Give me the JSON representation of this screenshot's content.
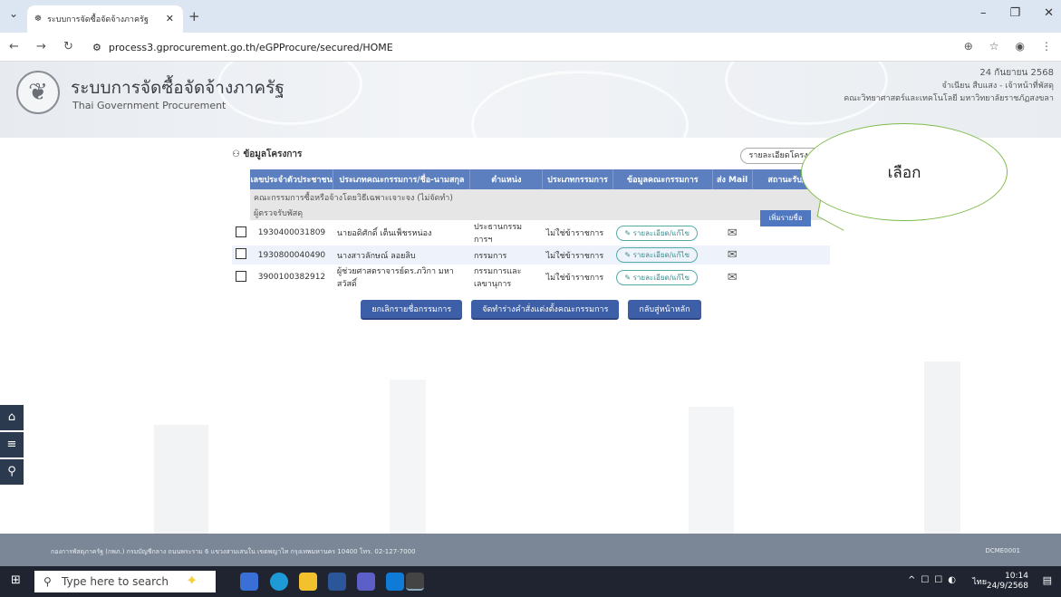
{
  "browser": {
    "tab_title": "ระบบการจัดซื้อจัดจ้างภาครัฐ",
    "url": "process3.gprocurement.go.th/eGPProcure/secured/HOME"
  },
  "header": {
    "title": "ระบบการจัดซื้อจัดจ้างภาครัฐ",
    "subtitle": "Thai Government Procurement",
    "date": "24 กันยายน 2568",
    "user": "จำเนียน สืบแสง - เจ้าหน้าที่พัสดุ",
    "org": "คณะวิทยาศาสตร์และเทคโนโลยี มหาวิทยาลัยราชภัฏสงขลา"
  },
  "panel": {
    "title": "ข้อมูลโครงการ",
    "detail_button": "รายละเอียดโครงการ",
    "columns": [
      "เลขประจำตัวประชาชน",
      "ประเภทคณะกรรมการ/ชื่อ-นามสกุล",
      "ตำแหน่ง",
      "ประเภทกรรมการ",
      "ข้อมูลคณะกรรมการ",
      "ส่ง Mail",
      "สถานะรับ/ส่ง"
    ],
    "section1": "คณะกรรมการซื้อหรือจ้างโดยวิธีเฉพาะเจาะจง (ไม่จัดทำ)",
    "section2": "ผู้ตรวจรับพัสดุ",
    "add_button": "เพิ่มรายชื่อ",
    "edit_label": "รายละเอียด/แก้ไข",
    "rows": [
      {
        "id": "1930400031809",
        "name": "นายอดิศักดิ์ เต็นเพ็ชรหน่อง",
        "position": "ประธานกรรมการฯ",
        "type": "ไม่ใช่ข้าราชการ"
      },
      {
        "id": "1930800040490",
        "name": "นางสาวลักษณ์ ลอยลิบ",
        "position": "กรรมการ",
        "type": "ไม่ใช่ข้าราชการ"
      },
      {
        "id": "3900100382912",
        "name": "ผู้ช่วยศาสตราจารย์ดร.ภวิกา มหาสวัสดิ์",
        "position": "กรรมการและ เลขานุการ",
        "type": "ไม่ใช่ข้าราชการ"
      }
    ],
    "actions": [
      "ยกเลิกรายชื่อกรรมการ",
      "จัดทำร่างคำสั่งแต่งตั้งคณะกรรมการ",
      "กลับสู่หน้าหลัก"
    ]
  },
  "callout": "เลือก",
  "footer": {
    "address": "กองการพัสดุภาครัฐ (กพภ.) กรมบัญชีกลาง ถนนพระราม 6 แขวงสามเสนใน เขตพญาไท กรุงเทพมหานคร 10400 โทร. 02-127-7000",
    "code": "DCME0001"
  },
  "taskbar": {
    "search_placeholder": "Type here to search",
    "lang": "ไทย",
    "time": "10:14",
    "date": "24/9/2568"
  }
}
